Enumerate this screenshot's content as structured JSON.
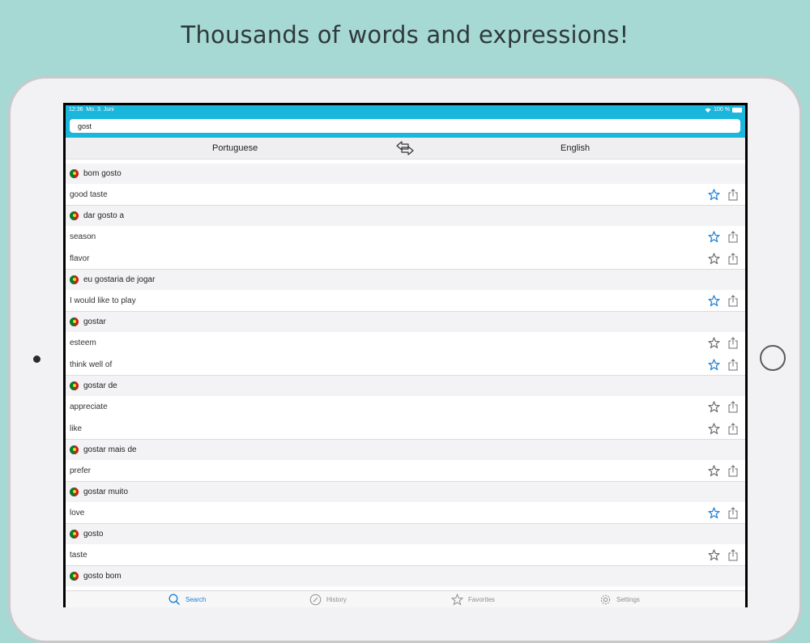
{
  "headline": "Thousands of words and expressions!",
  "status_bar": {
    "time": "12:36",
    "date": "Mo. 3. Juni",
    "battery": "100 %"
  },
  "search": {
    "value": "gost"
  },
  "languages": {
    "source": "Portuguese",
    "target": "English"
  },
  "entries": [
    {
      "term": "bom gosto",
      "translations": [
        {
          "text": "good taste",
          "favorite": true
        }
      ]
    },
    {
      "term": "dar gosto a",
      "translations": [
        {
          "text": "season",
          "favorite": true
        },
        {
          "text": "flavor",
          "favorite": false
        }
      ]
    },
    {
      "term": "eu gostaria de jogar",
      "translations": [
        {
          "text": "I would like to play",
          "favorite": true
        }
      ]
    },
    {
      "term": "gostar",
      "translations": [
        {
          "text": "esteem",
          "favorite": false
        },
        {
          "text": "think well of",
          "favorite": true
        }
      ]
    },
    {
      "term": "gostar de",
      "translations": [
        {
          "text": "appreciate",
          "favorite": false
        },
        {
          "text": "like",
          "favorite": false
        }
      ]
    },
    {
      "term": "gostar mais de",
      "translations": [
        {
          "text": "prefer",
          "favorite": false
        }
      ]
    },
    {
      "term": "gostar muito",
      "translations": [
        {
          "text": "love",
          "favorite": true
        }
      ]
    },
    {
      "term": "gosto",
      "translations": [
        {
          "text": "taste",
          "favorite": false
        }
      ]
    },
    {
      "term": "gosto bom",
      "translations": []
    }
  ],
  "tabs": [
    {
      "label": "Search",
      "icon": "search-icon",
      "active": true
    },
    {
      "label": "History",
      "icon": "compass-icon",
      "active": false
    },
    {
      "label": "Favorites",
      "icon": "star-icon",
      "active": false
    },
    {
      "label": "Settings",
      "icon": "gear-icon",
      "active": false
    }
  ],
  "colors": {
    "background": "#a6d8d4",
    "accent": "#1ab6dc",
    "favorite_star": "#1a7fd6",
    "inactive_star": "#6d6d72"
  }
}
